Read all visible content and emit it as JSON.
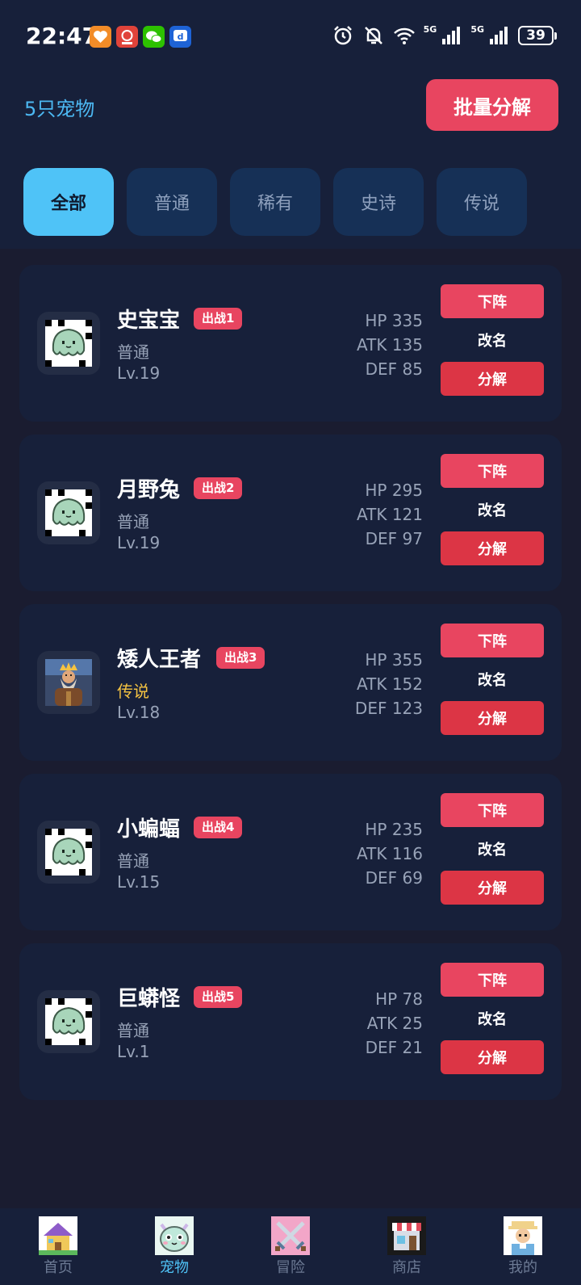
{
  "status_bar": {
    "time": "22:47",
    "net_label_1": "5G",
    "net_label_2": "5G",
    "battery": "39",
    "notification_icons": [
      "orange-heart-app-icon",
      "red-app-icon",
      "wechat-icon",
      "blue-d-app-icon"
    ],
    "system_icons": [
      "alarm-icon",
      "bell-muted-icon",
      "wifi-icon",
      "signal-icon",
      "signal-icon",
      "battery-icon"
    ]
  },
  "header": {
    "pet_count": "5只宠物",
    "batch_button": "批量分解"
  },
  "tabs": [
    {
      "label": "全部",
      "active": true
    },
    {
      "label": "普通",
      "active": false
    },
    {
      "label": "稀有",
      "active": false
    },
    {
      "label": "史诗",
      "active": false
    },
    {
      "label": "传说",
      "active": false
    }
  ],
  "pets": [
    {
      "name": "史宝宝",
      "badge": "出战1",
      "rarity": "普通",
      "level": "Lv.19",
      "hp": "HP 335",
      "atk": "ATK 135",
      "def": "DEF 85",
      "avatar_icon": "ghost-slime-icon"
    },
    {
      "name": "月野兔",
      "badge": "出战2",
      "rarity": "普通",
      "level": "Lv.19",
      "hp": "HP 295",
      "atk": "ATK 121",
      "def": "DEF 97",
      "avatar_icon": "ghost-slime-icon"
    },
    {
      "name": "矮人王者",
      "badge": "出战3",
      "rarity": "传说",
      "level": "Lv.18",
      "hp": "HP 355",
      "atk": "ATK 152",
      "def": "DEF 123",
      "avatar_icon": "dwarf-king-icon"
    },
    {
      "name": "小蝙蝠",
      "badge": "出战4",
      "rarity": "普通",
      "level": "Lv.15",
      "hp": "HP 235",
      "atk": "ATK 116",
      "def": "DEF 69",
      "avatar_icon": "ghost-slime-icon"
    },
    {
      "name": "巨蟒怪",
      "badge": "出战5",
      "rarity": "普通",
      "level": "Lv.1",
      "hp": "HP 78",
      "atk": "ATK 25",
      "def": "DEF 21",
      "avatar_icon": "ghost-slime-icon"
    }
  ],
  "actions": {
    "unequip": "下阵",
    "rename": "改名",
    "decompose": "分解"
  },
  "nav": [
    {
      "label": "首页",
      "icon": "house-icon",
      "active": false
    },
    {
      "label": "宠物",
      "icon": "pet-monster-icon",
      "active": true
    },
    {
      "label": "冒险",
      "icon": "crossed-swords-icon",
      "active": false
    },
    {
      "label": "商店",
      "icon": "shop-icon",
      "active": false
    },
    {
      "label": "我的",
      "icon": "profile-avatar-icon",
      "active": false
    }
  ],
  "colors": {
    "background": "#1a1c30",
    "panel": "#17203a",
    "accent_blue": "#4fc3f7",
    "accent_red": "#e84560",
    "decompose_red": "#dc3545",
    "legend_gold": "#f5c342",
    "muted_text": "#98a3b8"
  }
}
